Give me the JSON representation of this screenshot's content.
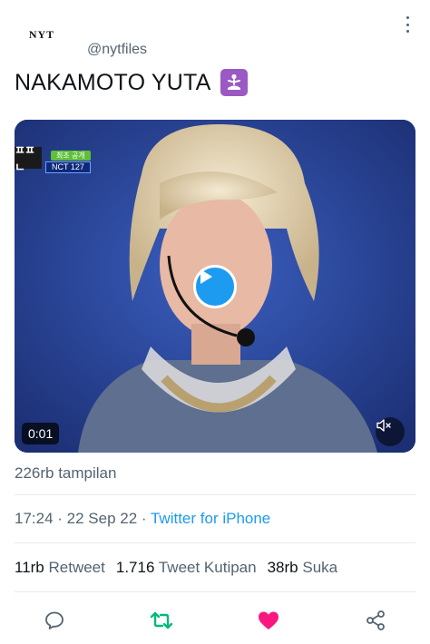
{
  "author": {
    "avatar_text": "NYT",
    "handle": "@nytfiles"
  },
  "tweet": {
    "text": "NAKAMOTO YUTA",
    "emoji_icon": "person-in-lotus-position-icon"
  },
  "media": {
    "broadcast_logo": "ㅍㅍㄴ",
    "tag_top": "최초 공개",
    "tag_bottom": "NCT 127",
    "time": "0:01",
    "play_icon": "play-icon",
    "mute_icon": "muted-speaker-icon"
  },
  "views": "226rb tampilan",
  "meta": {
    "time": "17:24",
    "separator": " · ",
    "date": "22 Sep 22",
    "source": "Twitter for iPhone"
  },
  "stats": {
    "retweets_count": "11rb",
    "retweets_label": "Retweet",
    "quotes_count": "1.716",
    "quotes_label": "Tweet Kutipan",
    "likes_count": "38rb",
    "likes_label": "Suka"
  },
  "actions": {
    "reply_icon": "reply-icon",
    "retweet_icon": "retweet-icon",
    "like_icon": "heart-icon",
    "share_icon": "share-icon"
  },
  "colors": {
    "accent": "#1d9bf0",
    "retweet": "#00ba7c",
    "like": "#f91880",
    "secondary_text": "#536471"
  }
}
